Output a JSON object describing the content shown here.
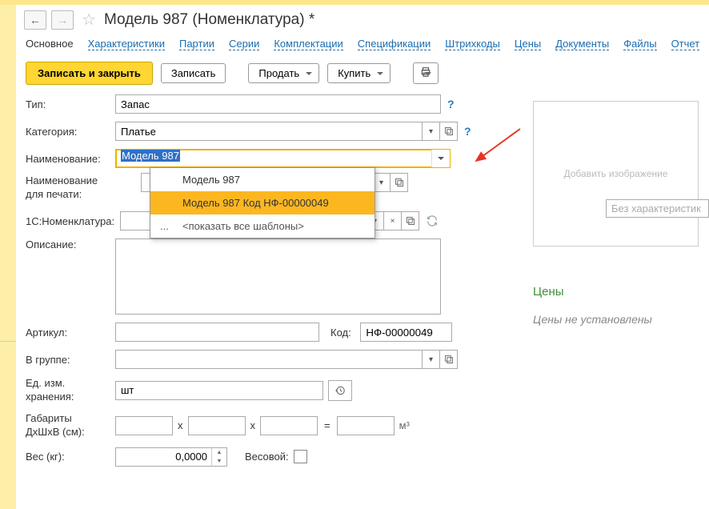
{
  "header": {
    "title": "Модель 987 (Номенклатура) *"
  },
  "tabs": {
    "main": "Основное",
    "chars": "Характеристики",
    "parties": "Партии",
    "series": "Серии",
    "complect": "Комплектации",
    "specs": "Спецификации",
    "barcodes": "Штрихкоды",
    "prices": "Цены",
    "docs": "Документы",
    "files": "Файлы",
    "reports": "Отчет"
  },
  "toolbar": {
    "save_close": "Записать и закрыть",
    "save": "Записать",
    "sell": "Продать",
    "buy": "Купить"
  },
  "form": {
    "type_label": "Тип:",
    "type_value": "Запас",
    "category_label": "Категория:",
    "category_value": "Платье",
    "name_label": "Наименование:",
    "name_value": "Модель 987",
    "name_print_label_1": "Наименование",
    "name_print_label_2": "для печати:",
    "nomen_label": "1С:Номенклатура:",
    "desc_label": "Описание:",
    "article_label": "Артикул:",
    "code_label": "Код:",
    "code_value": "НФ-00000049",
    "group_label": "В группе:",
    "unit_label_1": "Ед. изм.",
    "unit_label_2": "хранения:",
    "unit_value": "шт",
    "dims_label_1": "Габариты",
    "dims_label_2": "ДхШхВ (см):",
    "cube": "м³",
    "weight_label": "Вес (кг):",
    "weight_value": "0,0000",
    "weight_flag_label": "Весовой:"
  },
  "dropdown": {
    "opt1": "Модель 987",
    "opt2": "Модель 987 Код НФ-00000049",
    "opt3": "<показать все шаблоны>"
  },
  "right": {
    "img_placeholder": "Добавить изображение",
    "prices_title": "Цены",
    "no_prices": "Цены не установлены",
    "char_placeholder": "Без характеристик"
  }
}
